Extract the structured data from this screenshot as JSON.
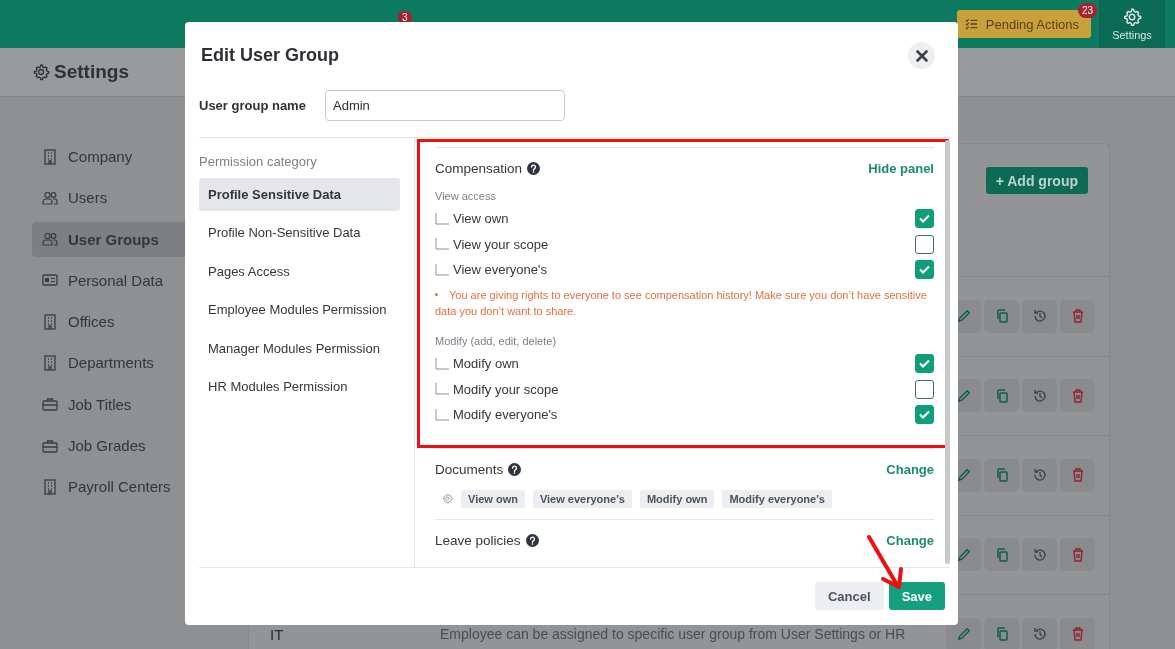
{
  "topbar": {
    "feed_badge": "3",
    "pending_actions": {
      "label": "Pending Actions",
      "badge": "23"
    },
    "settings": {
      "label": "Settings"
    }
  },
  "page_header": {
    "title": "Settings"
  },
  "sidebar": {
    "items": [
      {
        "label": "Company",
        "kind": "building",
        "selected": false
      },
      {
        "label": "Users",
        "kind": "users",
        "selected": false
      },
      {
        "label": "User Groups",
        "kind": "users",
        "selected": true
      },
      {
        "label": "Personal Data",
        "kind": "card",
        "selected": false
      },
      {
        "label": "Offices",
        "kind": "building",
        "selected": false
      },
      {
        "label": "Departments",
        "kind": "building",
        "selected": false
      },
      {
        "label": "Job Titles",
        "kind": "briefcase",
        "selected": false
      },
      {
        "label": "Job Grades",
        "kind": "briefcase",
        "selected": false
      },
      {
        "label": "Payroll Centers",
        "kind": "building",
        "selected": false
      }
    ]
  },
  "groups_card": {
    "add_button": "+ Add group",
    "rows": [
      {
        "kind": "group"
      },
      {
        "kind": "group"
      },
      {
        "kind": "group"
      },
      {
        "kind": "group"
      },
      {
        "kind": "group",
        "name": "IT",
        "description": "Employee can be assigned to specific user group from User Settings or HR"
      }
    ]
  },
  "modal": {
    "title": "Edit User Group",
    "name_field": {
      "label": "User group name",
      "value": "Admin"
    },
    "categories": {
      "heading": "Permission category",
      "items": [
        {
          "label": "Profile Sensitive Data",
          "selected": true
        },
        {
          "label": "Profile Non-Sensitive Data",
          "selected": false
        },
        {
          "label": "Pages Access",
          "selected": false
        },
        {
          "label": "Employee Modules Permission",
          "selected": false
        },
        {
          "label": "Manager Modules Permission",
          "selected": false
        },
        {
          "label": "HR Modules Permission",
          "selected": false
        }
      ]
    },
    "sections": [
      {
        "kind": "checklist",
        "highlighted": true,
        "title": "Compensation",
        "action": "Hide panel",
        "groups": [
          {
            "label": "View access",
            "items": [
              {
                "label": "View own",
                "checked": true
              },
              {
                "label": "View your scope",
                "checked": false
              },
              {
                "label": "View everyone's",
                "checked": true
              }
            ],
            "warning": "You are giving rights to everyone to see compensation history! Make sure you don’t have sensitive data you don’t want to share."
          },
          {
            "label": "Modify (add, edit, delete)",
            "items": [
              {
                "label": "Modify own",
                "checked": true
              },
              {
                "label": "Modify your scope",
                "checked": false
              },
              {
                "label": "Modify everyone's",
                "checked": true
              }
            ]
          }
        ]
      },
      {
        "kind": "chips",
        "title": "Documents",
        "action": "Change",
        "chips": [
          "View own",
          "View everyone's",
          "Modify own",
          "Modify everyone's"
        ]
      },
      {
        "kind": "chips",
        "title": "Leave policies",
        "action": "Change"
      }
    ],
    "buttons": [
      {
        "label": "Cancel",
        "kind": "secondary"
      },
      {
        "label": "Save",
        "kind": "primary"
      }
    ]
  },
  "annotations": [
    {
      "kind": "arrow"
    }
  ]
}
